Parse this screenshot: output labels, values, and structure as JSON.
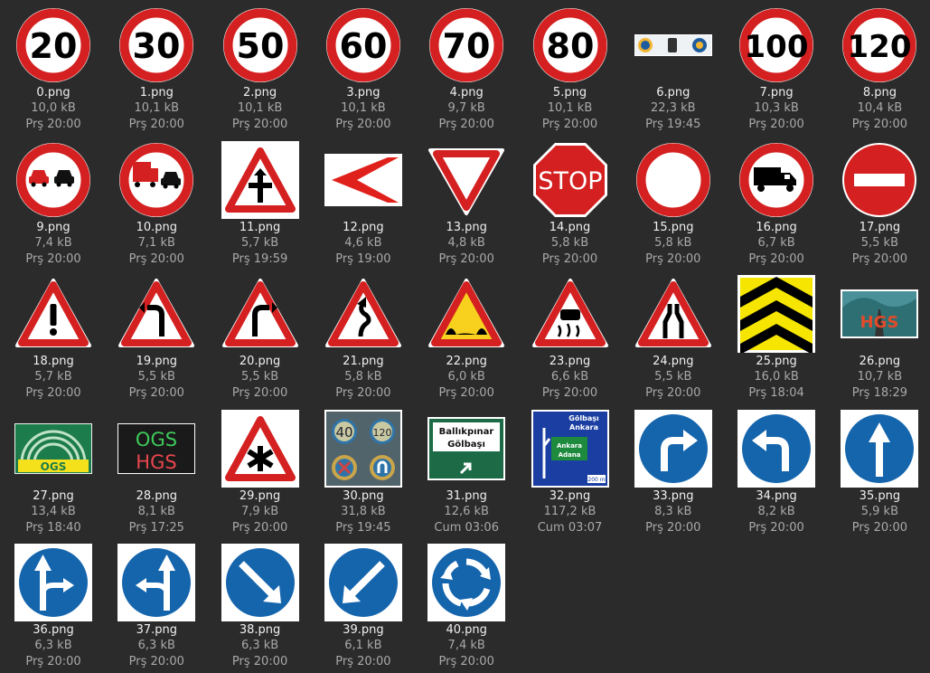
{
  "files": [
    {
      "name": "0.png",
      "size": "10,0 kB",
      "date": "Prş 20:00",
      "icon": "speed-limit-20-icon",
      "text": "20"
    },
    {
      "name": "1.png",
      "size": "10,1 kB",
      "date": "Prş 20:00",
      "icon": "speed-limit-30-icon",
      "text": "30"
    },
    {
      "name": "2.png",
      "size": "10,1 kB",
      "date": "Prş 20:00",
      "icon": "speed-limit-50-icon",
      "text": "50"
    },
    {
      "name": "3.png",
      "size": "10,1 kB",
      "date": "Prş 20:00",
      "icon": "speed-limit-60-icon",
      "text": "60"
    },
    {
      "name": "4.png",
      "size": "9,7 kB",
      "date": "Prş 20:00",
      "icon": "speed-limit-70-icon",
      "text": "70"
    },
    {
      "name": "5.png",
      "size": "10,1 kB",
      "date": "Prş 20:00",
      "icon": "speed-limit-80-icon",
      "text": "80"
    },
    {
      "name": "6.png",
      "size": "22,3 kB",
      "date": "Prş 19:45",
      "icon": "info-banner-icon",
      "text": ""
    },
    {
      "name": "7.png",
      "size": "10,3 kB",
      "date": "Prş 20:00",
      "icon": "speed-limit-100-icon",
      "text": "100"
    },
    {
      "name": "8.png",
      "size": "10,4 kB",
      "date": "Prş 20:00",
      "icon": "speed-limit-120-icon",
      "text": "120"
    },
    {
      "name": "9.png",
      "size": "7,4 kB",
      "date": "Prş 20:00",
      "icon": "no-overtaking-icon",
      "text": ""
    },
    {
      "name": "10.png",
      "size": "7,1 kB",
      "date": "Prş 20:00",
      "icon": "no-overtaking-trucks-icon",
      "text": ""
    },
    {
      "name": "11.png",
      "size": "5,7 kB",
      "date": "Prş 19:59",
      "icon": "crossroads-warning-icon",
      "text": ""
    },
    {
      "name": "12.png",
      "size": "4,6 kB",
      "date": "Prş 19:00",
      "icon": "chevron-left-board-icon",
      "text": ""
    },
    {
      "name": "13.png",
      "size": "4,8 kB",
      "date": "Prş 20:00",
      "icon": "yield-icon",
      "text": ""
    },
    {
      "name": "14.png",
      "size": "5,8 kB",
      "date": "Prş 20:00",
      "icon": "stop-icon",
      "text": "STOP"
    },
    {
      "name": "15.png",
      "size": "5,8 kB",
      "date": "Prş 20:00",
      "icon": "no-vehicles-icon",
      "text": ""
    },
    {
      "name": "16.png",
      "size": "6,7 kB",
      "date": "Prş 20:00",
      "icon": "no-trucks-icon",
      "text": ""
    },
    {
      "name": "17.png",
      "size": "5,5 kB",
      "date": "Prş 20:00",
      "icon": "no-entry-icon",
      "text": ""
    },
    {
      "name": "18.png",
      "size": "5,7 kB",
      "date": "Prş 20:00",
      "icon": "general-danger-icon",
      "text": ""
    },
    {
      "name": "19.png",
      "size": "5,5 kB",
      "date": "Prş 20:00",
      "icon": "curve-left-icon",
      "text": ""
    },
    {
      "name": "20.png",
      "size": "5,5 kB",
      "date": "Prş 20:00",
      "icon": "curve-right-icon",
      "text": ""
    },
    {
      "name": "21.png",
      "size": "5,8 kB",
      "date": "Prş 20:00",
      "icon": "double-curve-icon",
      "text": ""
    },
    {
      "name": "22.png",
      "size": "6,0 kB",
      "date": "Prş 20:00",
      "icon": "bumpy-road-icon",
      "text": ""
    },
    {
      "name": "23.png",
      "size": "6,6 kB",
      "date": "Prş 20:00",
      "icon": "slippery-road-icon",
      "text": ""
    },
    {
      "name": "24.png",
      "size": "5,5 kB",
      "date": "Prş 20:00",
      "icon": "road-narrows-icon",
      "text": ""
    },
    {
      "name": "25.png",
      "size": "16,0 kB",
      "date": "Prş 18:04",
      "icon": "chevron-up-board-icon",
      "text": ""
    },
    {
      "name": "26.png",
      "size": "10,7 kB",
      "date": "Prş 18:29",
      "icon": "hgs-photo-icon",
      "text": "HGS"
    },
    {
      "name": "27.png",
      "size": "13,4 kB",
      "date": "Prş 18:40",
      "icon": "ogs-logo-icon",
      "text": "OGS"
    },
    {
      "name": "28.png",
      "size": "8,1 kB",
      "date": "Prş 17:25",
      "icon": "ogs-hgs-led-icon",
      "text": "OGS HGS"
    },
    {
      "name": "29.png",
      "size": "7,9 kB",
      "date": "Prş 20:00",
      "icon": "other-danger-icon",
      "text": ""
    },
    {
      "name": "30.png",
      "size": "31,8 kB",
      "date": "Prş 19:45",
      "icon": "signs-photo-icon",
      "text": ""
    },
    {
      "name": "31.png",
      "size": "12,6 kB",
      "date": "Cum 03:06",
      "icon": "direction-board-icon",
      "text": "Ballıkpınar Gölbaşı"
    },
    {
      "name": "32.png",
      "size": "117,2 kB",
      "date": "Cum 03:07",
      "icon": "highway-exit-board-icon",
      "text": "Gölbaşı Ankara"
    },
    {
      "name": "33.png",
      "size": "8,3 kB",
      "date": "Prş 20:00",
      "icon": "turn-right-ahead-icon",
      "text": ""
    },
    {
      "name": "34.png",
      "size": "8,2 kB",
      "date": "Prş 20:00",
      "icon": "turn-left-ahead-icon",
      "text": ""
    },
    {
      "name": "35.png",
      "size": "5,9 kB",
      "date": "Prş 20:00",
      "icon": "ahead-only-icon",
      "text": ""
    },
    {
      "name": "36.png",
      "size": "6,3 kB",
      "date": "Prş 20:00",
      "icon": "straight-or-right-icon",
      "text": ""
    },
    {
      "name": "37.png",
      "size": "6,3 kB",
      "date": "Prş 20:00",
      "icon": "straight-or-left-icon",
      "text": ""
    },
    {
      "name": "38.png",
      "size": "6,3 kB",
      "date": "Prş 20:00",
      "icon": "keep-right-icon",
      "text": ""
    },
    {
      "name": "39.png",
      "size": "6,1 kB",
      "date": "Prş 20:00",
      "icon": "keep-left-icon",
      "text": ""
    },
    {
      "name": "40.png",
      "size": "7,4 kB",
      "date": "Prş 20:00",
      "icon": "roundabout-icon",
      "text": ""
    }
  ],
  "colors": {
    "background": "#2b2b2b",
    "red": "#d42020",
    "blue": "#1565ad",
    "yellow": "#f7d11e",
    "white": "#ffffff"
  }
}
